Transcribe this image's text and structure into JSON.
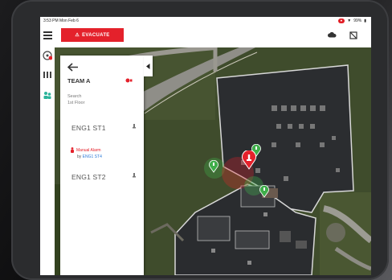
{
  "statusbar": {
    "time": "3:53 PM",
    "date": "Mon Feb 6",
    "rec_label": "",
    "battery": "99%"
  },
  "topbar": {
    "evacuate_label": "EVACUATE",
    "evacuate_icon": "alarm-bell-icon"
  },
  "colors": {
    "alert_red": "#e4212b",
    "pin_green": "#3fae4a",
    "link_blue": "#2d7bd8"
  },
  "panel": {
    "team_name": "TEAM A",
    "search_label": "Search",
    "floor_label": "1st Floor",
    "stations": [
      {
        "name": "ENG1 ST1"
      },
      {
        "name": "ENG1 ST2"
      }
    ],
    "alarm": {
      "title": "Manual Alarm",
      "by_prefix": "by",
      "by_station": "ENG1 ST4"
    }
  }
}
